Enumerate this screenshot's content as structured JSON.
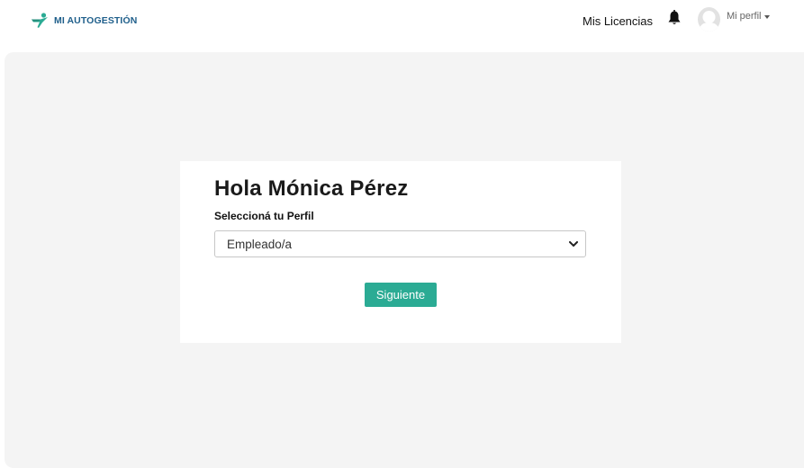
{
  "header": {
    "brand_text": "MI AUTOGESTIÓN",
    "brand_color": "#1f5f8b",
    "nav": {
      "licencias_label": "Mis Licencias",
      "bell_icon": "bell-icon",
      "avatar_icon": "avatar-placeholder-icon",
      "perfil_label": "Mi perfil"
    }
  },
  "card": {
    "greeting": "Hola Mónica Pérez",
    "select_label": "Seleccioná tu Perfil",
    "select_value": "Empleado/a",
    "next_button_label": "Siguiente",
    "accent_color": "#2bab94"
  }
}
